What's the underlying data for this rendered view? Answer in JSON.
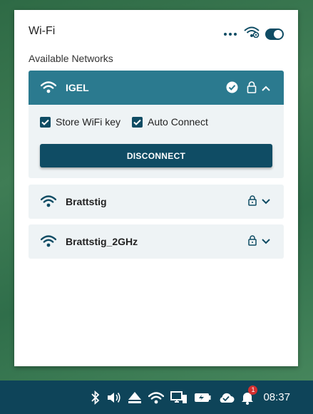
{
  "panel": {
    "title": "Wi-Fi",
    "section_label": "Available Networks",
    "toggle_on": true
  },
  "networks": [
    {
      "name": "IGEL",
      "connected": true,
      "secured": true,
      "expanded": true,
      "store_key_label": "Store WiFi key",
      "store_key_checked": true,
      "auto_connect_label": "Auto Connect",
      "auto_connect_checked": true,
      "action_label": "DISCONNECT"
    },
    {
      "name": "Brattstig",
      "secured": true,
      "expanded": false
    },
    {
      "name": "Brattstig_2GHz",
      "secured": true,
      "expanded": false
    }
  ],
  "taskbar": {
    "clock": "08:37",
    "notification_count": "1",
    "icons": [
      "bluetooth-icon",
      "volume-icon",
      "eject-icon",
      "wifi-icon",
      "monitor-network-icon",
      "battery-icon",
      "cloud-check-icon",
      "bell-icon"
    ]
  },
  "colors": {
    "accent": "#0f4c64",
    "active_row": "#2b7a8f",
    "row_bg": "#eef3f5",
    "taskbar": "#0e4459"
  }
}
